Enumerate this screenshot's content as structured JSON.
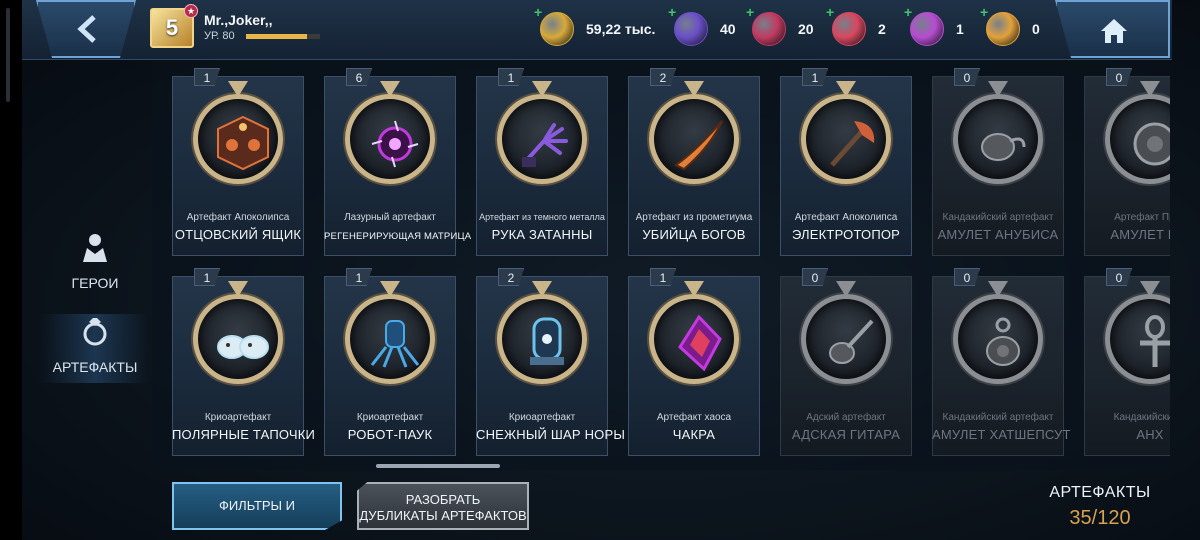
{
  "player": {
    "name": "Mr.,Joker,,",
    "level": "УР. 80",
    "badge": "5",
    "xp_fraction": 0.82
  },
  "resources": [
    {
      "icon": "gold-coin-icon",
      "value": "59,22 тыс.",
      "color": "#d6a93b"
    },
    {
      "icon": "purple-orb-icon",
      "value": "40",
      "color": "#6a4fc9"
    },
    {
      "icon": "crimson-orb-icon",
      "value": "20",
      "color": "#c23a62"
    },
    {
      "icon": "planet-orb-icon",
      "value": "2",
      "color": "#d84760"
    },
    {
      "icon": "multicolor-orb-icon",
      "value": "1",
      "color": "#b74cd1"
    },
    {
      "icon": "golden-orb-icon",
      "value": "0",
      "color": "#e3a23b"
    }
  ],
  "nav": {
    "heroes": "ГЕРОИ",
    "artifacts": "АРТЕФАКТЫ"
  },
  "artifacts_row1": [
    {
      "count": "1",
      "type": "Артефакт Апоколипса",
      "name": "ОТЦОВСКИЙ ЯЩИК",
      "icon": "cube-icon",
      "color": "#e0733a",
      "locked": false
    },
    {
      "count": "6",
      "type": "Лазурный артефакт",
      "name": "РЕГЕНЕРИРУЮЩАЯ МАТРИЦА",
      "icon": "matrix-orb-icon",
      "color": "#c03bdc",
      "locked": false
    },
    {
      "count": "1",
      "type": "Артефакт из темного металла",
      "name": "РУКА ЗАТАННЫ",
      "icon": "claw-hand-icon",
      "color": "#8a5adc",
      "locked": false
    },
    {
      "count": "2",
      "type": "Артефакт из прометиума",
      "name": "УБИЙЦА БОГОВ",
      "icon": "blade-icon",
      "color": "#e0803a",
      "locked": false
    },
    {
      "count": "1",
      "type": "Артефакт Апоколипса",
      "name": "ЭЛЕКТРОТОПОР",
      "icon": "axe-icon",
      "color": "#d0603a",
      "locked": false
    },
    {
      "count": "0",
      "type": "Кандакийский артефакт",
      "name": "АМУЛЕТ АНУБИСА",
      "icon": "amulet-icon",
      "color": "#9aa0a6",
      "locked": true
    },
    {
      "count": "0",
      "type": "Артефакт Преи",
      "name": "АМУЛЕТ ШИ",
      "icon": "disc-amulet-icon",
      "color": "#9aa0a6",
      "locked": true
    }
  ],
  "artifacts_row2": [
    {
      "count": "1",
      "type": "Криоартефакт",
      "name": "ПОЛЯРНЫЕ ТАПОЧКИ",
      "icon": "slippers-icon",
      "color": "#b8dff2",
      "locked": false
    },
    {
      "count": "1",
      "type": "Криоартефакт",
      "name": "РОБОТ-ПАУК",
      "icon": "spider-robot-icon",
      "color": "#4aa9e8",
      "locked": false
    },
    {
      "count": "2",
      "type": "Криоартефакт",
      "name": "СНЕЖНЫЙ ШАР НОРЫ",
      "icon": "snow-globe-icon",
      "color": "#6ec2ee",
      "locked": false
    },
    {
      "count": "1",
      "type": "Артефакт хаоса",
      "name": "ЧАКРА",
      "icon": "chakra-gem-icon",
      "color": "#c33be0",
      "locked": false
    },
    {
      "count": "0",
      "type": "Адский артефакт",
      "name": "АДСКАЯ ГИТАРА",
      "icon": "guitar-icon",
      "color": "#9aa0a6",
      "locked": true
    },
    {
      "count": "0",
      "type": "Кандакийский артефакт",
      "name": "АМУЛЕТ ХАТШЕПСУТ",
      "icon": "scarab-amulet-icon",
      "color": "#9aa0a6",
      "locked": true
    },
    {
      "count": "0",
      "type": "Кандакийский а",
      "name": "АНХ",
      "icon": "ankh-icon",
      "color": "#9aa0a6",
      "locked": true
    }
  ],
  "buttons": {
    "filter": "ФИЛЬТРЫ И СОРТИРОВКА",
    "dups_line1": "РАЗОБРАТЬ",
    "dups_line2": "ДУБЛИКАТЫ АРТЕФАКТОВ"
  },
  "summary": {
    "title": "АРТЕФАКТЫ",
    "count": "35/120"
  }
}
